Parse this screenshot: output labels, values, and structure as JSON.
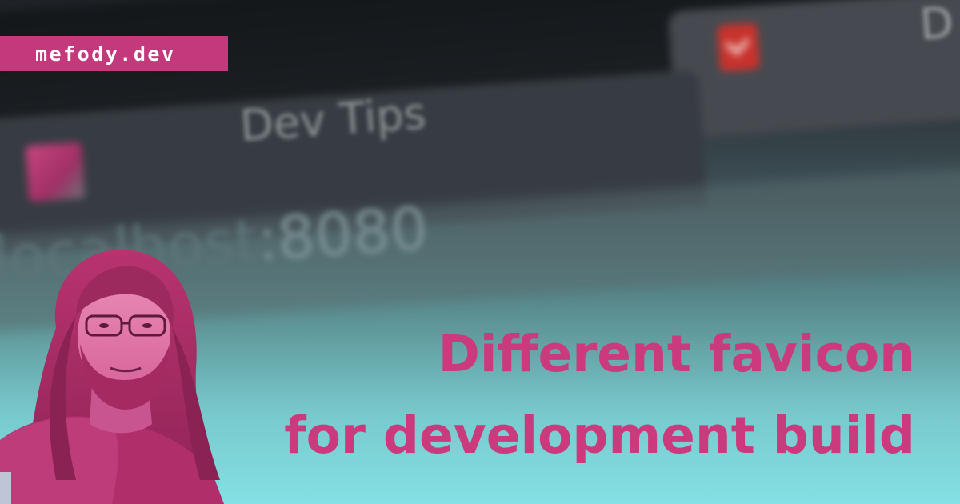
{
  "brand": {
    "label": "mefody.dev"
  },
  "headline": {
    "line1": "Different favicon",
    "line2": "for development build"
  },
  "background": {
    "tab_title": "Dev Tips",
    "tab_title_partial": "D",
    "url_text": "localhost",
    "url_port": ":8080"
  },
  "colors": {
    "accent": "#cc3a7e",
    "brand_bg": "#c3397c",
    "bg_top": "#1f2328",
    "bg_bottom": "#84e0e4"
  },
  "icons": {
    "dev_favicon": "dev-favicon-icon",
    "prod_favicon": "prod-favicon-icon"
  }
}
